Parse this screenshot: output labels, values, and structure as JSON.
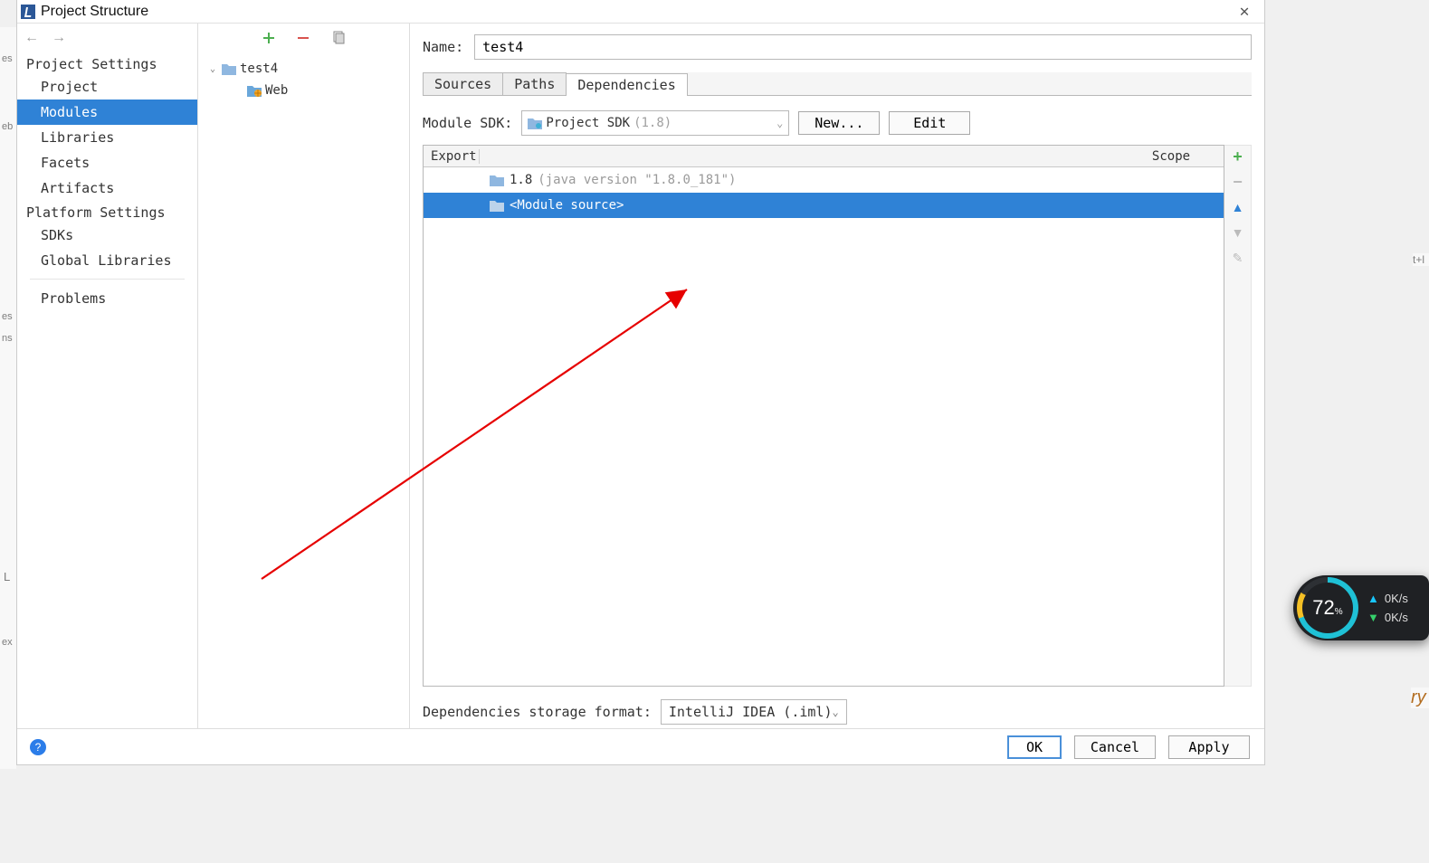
{
  "window_title": "Project Structure",
  "sidebar": {
    "group1": "Project Settings",
    "items1": [
      "Project",
      "Modules",
      "Libraries",
      "Facets",
      "Artifacts"
    ],
    "selected1": "Modules",
    "group2": "Platform Settings",
    "items2": [
      "SDKs",
      "Global Libraries"
    ],
    "problems": "Problems"
  },
  "tree": {
    "root": "test4",
    "child": "Web"
  },
  "name_label": "Name:",
  "name_value": "test4",
  "tabs": [
    "Sources",
    "Paths",
    "Dependencies"
  ],
  "active_tab": "Dependencies",
  "module_sdk_label": "Module SDK:",
  "module_sdk_value": "Project SDK",
  "module_sdk_version": "(1.8)",
  "new_button": "New...",
  "edit_button": "Edit",
  "dep_headers": {
    "export": "Export",
    "scope": "Scope"
  },
  "dep_rows": [
    {
      "main": "1.8",
      "extra": "(java version \"1.8.0_181\")",
      "icon": "sdk",
      "selected": false
    },
    {
      "main": "<Module source>",
      "extra": "",
      "icon": "folder",
      "selected": true
    }
  ],
  "storage_label": "Dependencies storage format:",
  "storage_value": "IntelliJ IDEA (.iml)",
  "footer": {
    "ok": "OK",
    "cancel": "Cancel",
    "apply": "Apply"
  },
  "net_widget": {
    "percent": "72",
    "unit": "%",
    "up": "0K/s",
    "down": "0K/s"
  },
  "bg_fragments": {
    "left_top": "es",
    "left_mid": "eb",
    "left_low": "es",
    "left_low2": "ns",
    "left_L": "L",
    "left_ex": "ex",
    "right_tl": "t+l",
    "right_ry": "ry"
  }
}
